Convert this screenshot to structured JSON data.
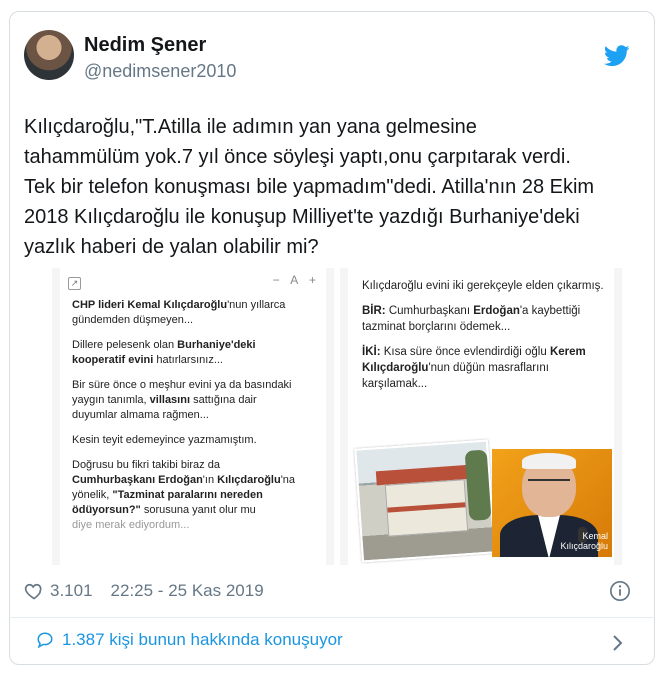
{
  "author": {
    "display_name": "Nedim Şener",
    "handle": "@nedimsener2010"
  },
  "tweet": {
    "text_lines": [
      "Kılıçdaroğlu,\"T.Atilla ile adımın yan yana gelmesine",
      "tahammülüm yok.7 yıl önce söyleşi yaptı,onu çarpıtarak verdi.",
      "Tek bir telefon konuşması bile yapmadım\"dedi. Atilla'nın 28 Ekim",
      "2018 Kılıçdaroğlu ile konuşup Milliyet'te yazdığı Burhaniye'deki",
      "yazlık haberi de yalan olabilir mi?"
    ]
  },
  "media": {
    "left": {
      "font_controls": "− A +",
      "p1_bold": "CHP lideri Kemal Kılıçdaroğlu",
      "p1_rest": "'nun yıllarca gündemden düşmeyen...",
      "p2_start": "Dillere pelesenk olan ",
      "p2_bold": "Burhaniye'deki kooperatif evini",
      "p2_rest": " hatırlarsınız...",
      "p3_start": "Bir süre önce o meşhur evini ya da basındaki yaygın tanımla, ",
      "p3_bold": "villasını",
      "p3_rest": " sattığına dair duyumlar almama rağmen...",
      "p4": "Kesin teyit edemeyince yazmamıştım.",
      "p5_start": "Doğrusu bu fikri takibi biraz da ",
      "p5_bold1": "Cumhurbaşkanı Erdoğan",
      "p5_mid1": "'ın ",
      "p5_bold2": "Kılıçdar­oğlu",
      "p5_mid2": "'na yönelik, ",
      "p5_bold3": "\"Tazminat paralarını nereden ödüyorsun?\"",
      "p5_rest": " sorusuna yanıt olur mu",
      "p5_tail": "diye merak ediyordum..."
    },
    "right": {
      "p1": "Kılıçdaroğlu evini iki gerekçeyle elden çıkarmış.",
      "p2_bold1": "BİR:",
      "p2_mid": " Cumhurbaşkanı ",
      "p2_bold2": "Erdoğan",
      "p2_rest": "'a kaybettiği tazminat borçlarını ödemek...",
      "p3_bold1": "İKİ:",
      "p3_mid": " Kısa süre önce evlendirdiği oğlu ",
      "p3_bold2": "Kerem Kılıçdaroğlu",
      "p3_rest": "'nun düğün masraflarını karşılamak...",
      "photo_caption": "Kemal Kılıçdaroğlu"
    }
  },
  "footer": {
    "like_count": "3.101",
    "timestamp": "22:25 - 25 Kas 2019",
    "conversation": "1.387 kişi bunun hakkında konuşuyor"
  },
  "colors": {
    "twitter_blue": "#1da1f2",
    "link_blue": "#1b95e0",
    "muted": "#657786"
  },
  "icons": [
    "twitter-bird-icon",
    "share-icon",
    "heart-icon",
    "info-icon",
    "speech-bubble-icon",
    "chevron-right-icon"
  ]
}
